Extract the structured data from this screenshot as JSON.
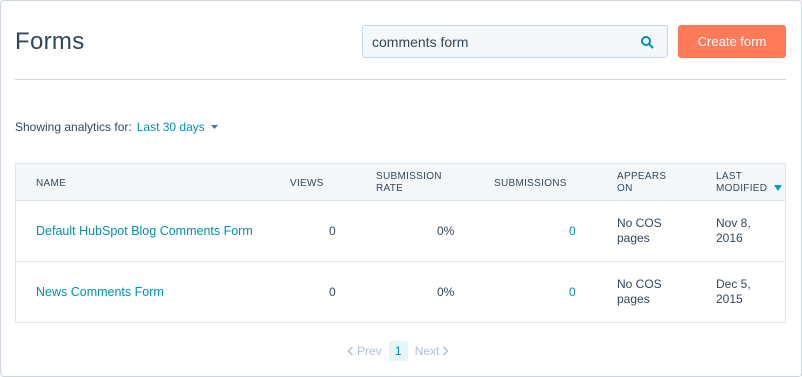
{
  "header": {
    "title": "Forms",
    "search_value": "comments form",
    "create_label": "Create form"
  },
  "analytics": {
    "label": "Showing analytics for:",
    "range": "Last 30 days"
  },
  "table": {
    "columns": {
      "name": "NAME",
      "views": "VIEWS",
      "rate_1": "SUBMISSION",
      "rate_2": "RATE",
      "submissions": "SUBMISSIONS",
      "appears_1": "APPEARS",
      "appears_2": "ON",
      "modified_1": "LAST",
      "modified_2": "MODIFIED"
    },
    "rows": [
      {
        "name": "Default HubSpot Blog Comments Form",
        "views": "0",
        "rate": "0%",
        "submissions": "0",
        "appears_1": "No COS",
        "appears_2": "pages",
        "modified_1": "Nov 8,",
        "modified_2": "2016"
      },
      {
        "name": "News Comments Form",
        "views": "0",
        "rate": "0%",
        "submissions": "0",
        "appears_1": "No COS",
        "appears_2": "pages",
        "modified_1": "Dec 5,",
        "modified_2": "2015"
      }
    ]
  },
  "pagination": {
    "prev": "Prev",
    "current": "1",
    "next": "Next"
  },
  "colors": {
    "accent": "#ff7a59",
    "link": "#0091ae",
    "text": "#33475b",
    "border": "#cbd6e2"
  },
  "icons": {
    "search": "search-icon",
    "caret": "caret-down-icon",
    "sort": "sort-desc-icon",
    "prev": "chevron-left-icon",
    "next": "chevron-right-icon"
  }
}
